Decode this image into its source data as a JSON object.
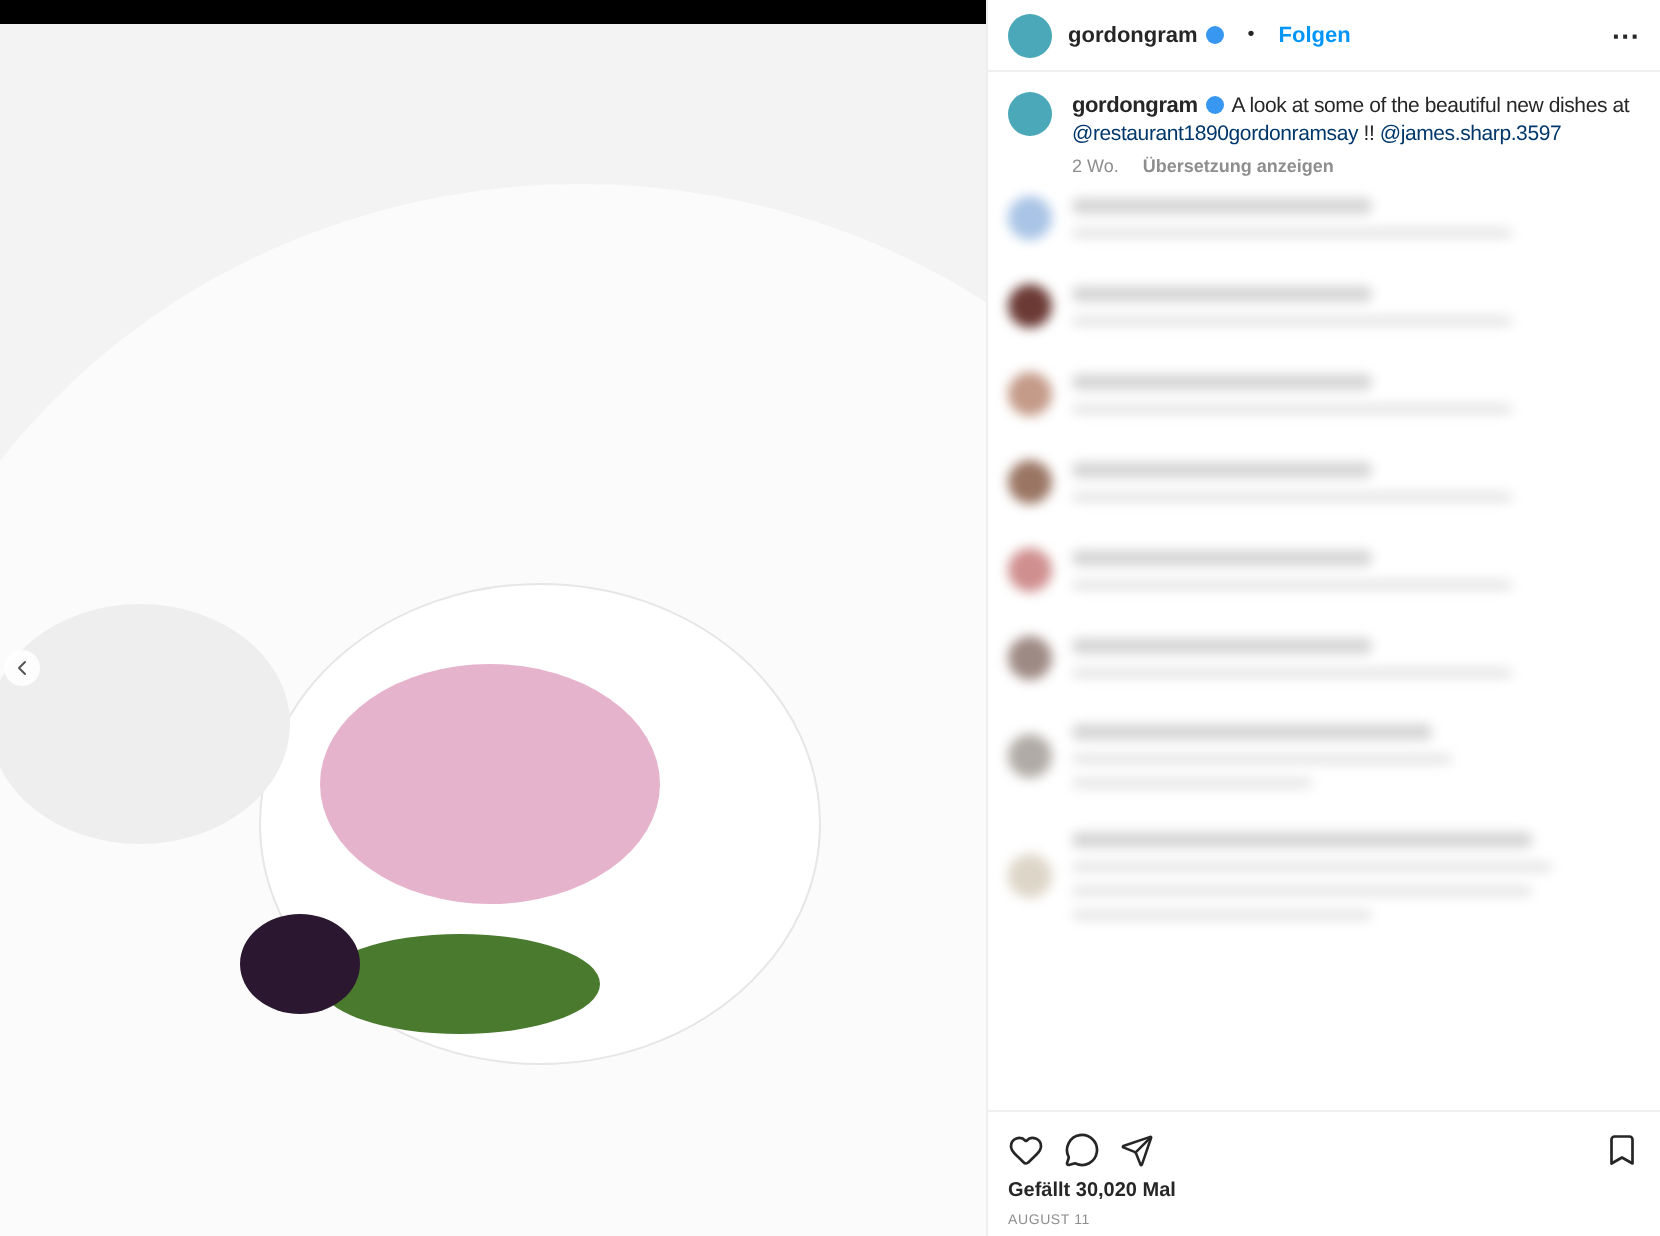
{
  "header": {
    "username": "gordongram",
    "verified": true,
    "separator": "•",
    "follow": "Folgen",
    "more": "···"
  },
  "caption": {
    "username": "gordongram",
    "verified": true,
    "text": "A look at some of the beautiful new dishes at",
    "mentions": [
      "@restaurant1890gordonramsay",
      "!!",
      "@james.sharp.3597"
    ],
    "age": "2 Wo.",
    "translate": "Übersetzung anzeigen"
  },
  "comments": [
    {
      "kind": "short",
      "color": "#a9c4e6"
    },
    {
      "kind": "short",
      "color": "#6b3a35"
    },
    {
      "kind": "short",
      "color": "#c49a88"
    },
    {
      "kind": "short",
      "color": "#9a7563"
    },
    {
      "kind": "short",
      "color": "#d08f8f"
    },
    {
      "kind": "short",
      "color": "#9e8a84"
    },
    {
      "kind": "reply",
      "color": "#b0aba6"
    },
    {
      "kind": "long",
      "color": "#ddd6c8"
    }
  ],
  "likes": "Gefällt 30,020 Mal",
  "date": "AUGUST 11"
}
